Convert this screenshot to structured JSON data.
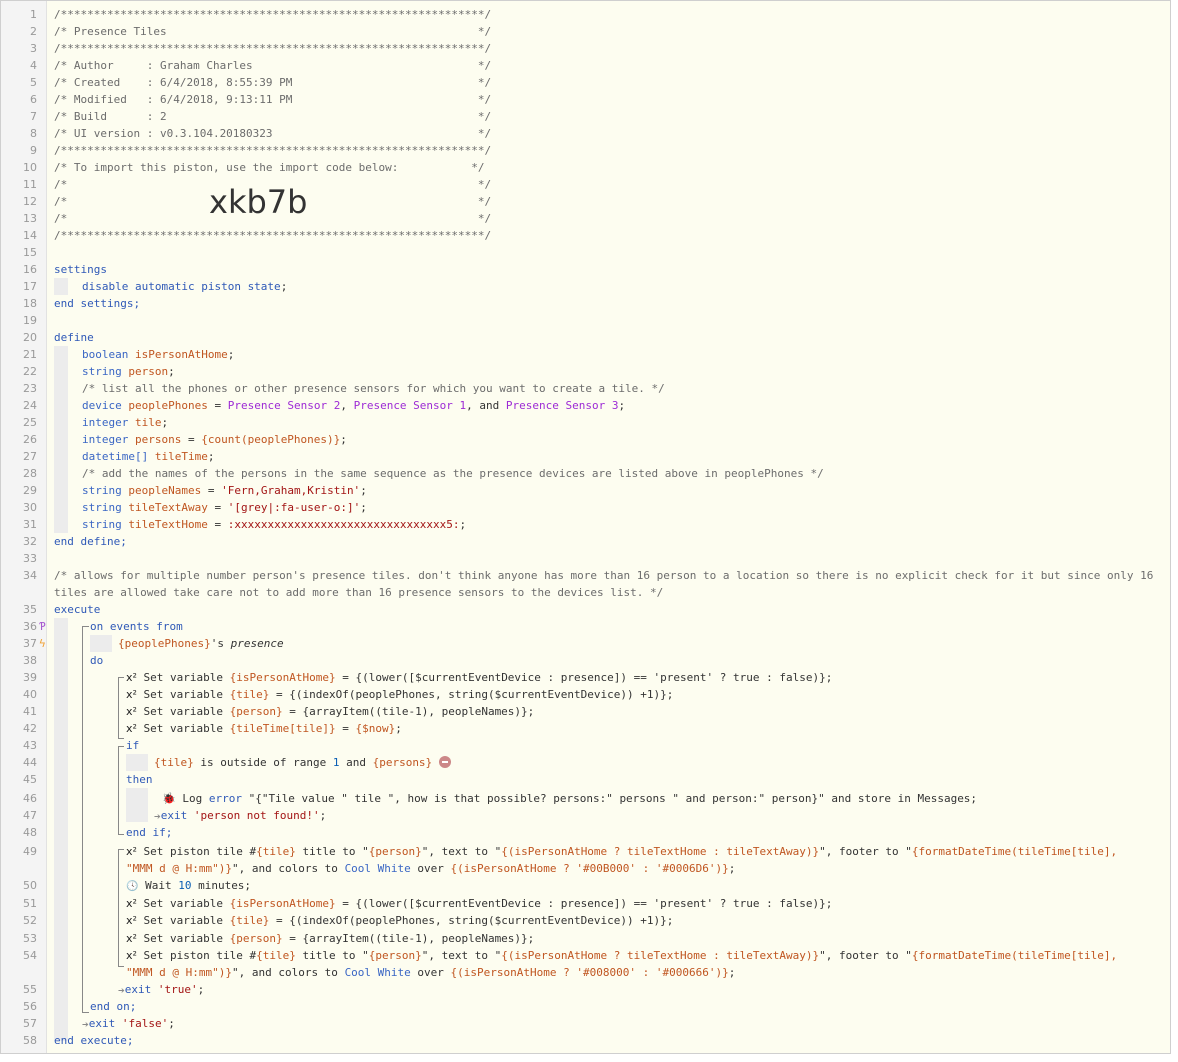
{
  "header": [
    "/****************************************************************/",
    "/* Presence Tiles                                               */",
    "/****************************************************************/",
    "/* Author     : Graham Charles                                  */",
    "/* Created    : 6/4/2018, 8:55:39 PM                            */",
    "/* Modified   : 6/4/2018, 9:13:11 PM                            */",
    "/* Build      : 2                                               */",
    "/* UI version : v0.3.104.20180323                               */",
    "/****************************************************************/",
    "/* To import this piston, use the import code below:           */",
    "/*                                                              */",
    "/*                                                              */",
    "/*                                                              */",
    "/****************************************************************/"
  ],
  "import_code": "xkb7b",
  "line_numbers": [
    "1",
    "2",
    "3",
    "4",
    "5",
    "6",
    "7",
    "8",
    "9",
    "10",
    "11",
    "12",
    "13",
    "14",
    "15",
    "16",
    "17",
    "18",
    "19",
    "20",
    "21",
    "22",
    "23",
    "24",
    "25",
    "26",
    "27",
    "28",
    "29",
    "30",
    "31",
    "32",
    "33",
    "34",
    "35",
    "36",
    "37",
    "38",
    "39",
    "40",
    "41",
    "42",
    "43",
    "44",
    "45",
    "46",
    "47",
    "48",
    "49",
    "50",
    "51",
    "52",
    "53",
    "54",
    "55",
    "56",
    "57",
    "58"
  ],
  "settings": {
    "open": "settings",
    "line": [
      "disable automatic piston state",
      ";"
    ],
    "close": "end settings;"
  },
  "define": {
    "open": "define",
    "l21": [
      "boolean",
      "isPersonAtHome",
      ";"
    ],
    "l22": [
      "string",
      "person",
      ";"
    ],
    "l23": "/* list all the phones or other presence sensors for which you want to create a tile. */",
    "l24": [
      "device",
      "peoplePhones",
      " = ",
      "Presence Sensor 2",
      ", ",
      "Presence Sensor 1",
      ", and ",
      "Presence Sensor 3",
      ";"
    ],
    "l25": [
      "integer",
      "tile",
      ";"
    ],
    "l26": [
      "integer",
      "persons",
      " = ",
      "{count(peoplePhones)}",
      ";"
    ],
    "l27": [
      "datetime[]",
      "tileTime",
      ";"
    ],
    "l28": "/* add the names of the persons in the same sequence as the presence devices are listed above in peoplePhones */",
    "l29": [
      "string",
      "peopleNames",
      " = ",
      "'Fern,Graham,Kristin'",
      ";"
    ],
    "l30": [
      "string",
      "tileTextAway",
      " = ",
      "'[grey|:fa-user-o:]'",
      ";"
    ],
    "l31": [
      "string",
      "tileTextHome",
      " = ",
      ":xxxxxxxxxxxxxxxxxxxxxxxxxxxxxxxx5:",
      ";"
    ],
    "close": "end define;"
  },
  "l34_comment": "/* allows for multiple number person's presence tiles. don't think anyone has more than 16 person to a location so there is no explicit check for it but since only 16 tiles are allowed take care not to add more than 16 presence sensors to the devices list. */",
  "execute": {
    "open": "execute",
    "on_events": "on events from",
    "trigger": [
      "{peoplePhones}",
      "'s ",
      "presence"
    ],
    "do": "do",
    "set_label": "Set variable",
    "l39": [
      "{isPersonAtHome}",
      " = {(lower([$currentEventDevice : presence]) == 'present' ? true : false)};"
    ],
    "l40": [
      "{tile}",
      " = {(indexOf(peoplePhones, string($currentEventDevice)) +1)};"
    ],
    "l41": [
      "{person}",
      " = {arrayItem((tile-1), peopleNames)};"
    ],
    "l42": [
      "{tileTime[tile]}",
      " = ",
      "{$now}",
      ";"
    ],
    "if": "if",
    "l44": [
      "{tile}",
      " is outside of range ",
      "1",
      " and ",
      "{persons}"
    ],
    "then": "then",
    "l46": [
      "Log ",
      "error",
      " \"{\"Tile value \" tile \", how is that possible? persons:\" persons \" and person:\" person}\" and store in Messages;"
    ],
    "l47": [
      "exit ",
      "'person not found!'",
      ";"
    ],
    "end_if": "end if;",
    "l49a": [
      "Set piston tile #",
      "{tile}",
      " title to \"",
      "{person}",
      "\", text to \"",
      "{(isPersonAtHome ? tileTextHome : tileTextAway)}",
      "\", footer to \"",
      "{formatDateTime(tileTime[tile],"
    ],
    "l49b": [
      "\"MMM d @ H:mm\")}",
      "\", and colors to ",
      "Cool White",
      " over ",
      "{(isPersonAtHome ? '#00B000' : '#0006D6')}",
      ";"
    ],
    "l50": [
      "Wait ",
      "10",
      " minutes;"
    ],
    "l51": [
      "{isPersonAtHome}",
      " = {(lower([$currentEventDevice : presence]) == 'present' ? true : false)};"
    ],
    "l52": [
      "{tile}",
      " = {(indexOf(peoplePhones, string($currentEventDevice)) +1)};"
    ],
    "l53": [
      "{person}",
      " = {arrayItem((tile-1), peopleNames)};"
    ],
    "l54a": [
      "Set piston tile #",
      "{tile}",
      " title to \"",
      "{person}",
      "\", text to \"",
      "{(isPersonAtHome ? tileTextHome : tileTextAway)}",
      "\", footer to \"",
      "{formatDateTime(tileTime[tile],"
    ],
    "l54b": [
      "\"MMM d @ H:mm\")}",
      "\", and colors to ",
      "Cool White",
      " over ",
      "{(isPersonAtHome ? '#008000' : '#000666')}",
      ";"
    ],
    "l55": [
      "exit ",
      "'true'",
      ";"
    ],
    "end_on": "end on;",
    "l57": [
      "exit ",
      "'false'",
      ";"
    ],
    "close": "end execute;"
  },
  "icons": {
    "x2": "x²",
    "clock": "clock-icon",
    "bug": "bug-icon",
    "exit": "exit-arrow-icon"
  }
}
